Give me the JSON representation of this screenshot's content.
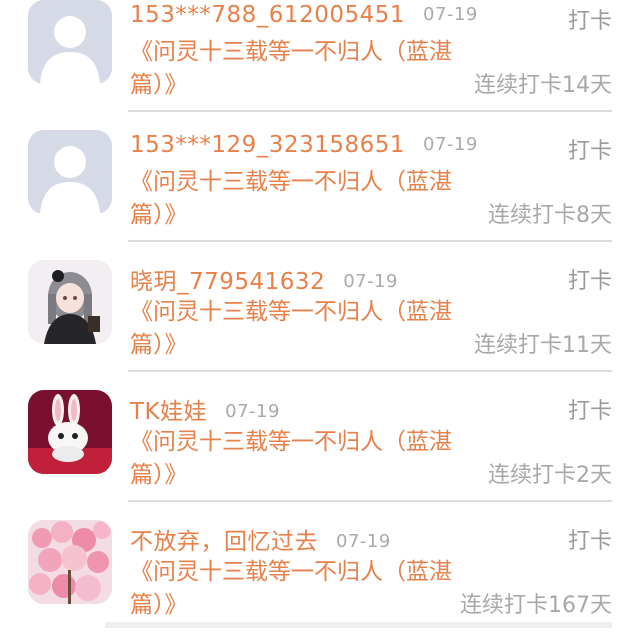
{
  "feed": {
    "items": [
      {
        "username": "153***788_612005451",
        "date": "07-19",
        "action": "打卡",
        "book": "《问灵十三载等一不归人（蓝湛篇）》",
        "streak": "连续打卡14天",
        "avatar": "default-avatar"
      },
      {
        "username": "153***129_323158651",
        "date": "07-19",
        "action": "打卡",
        "book": "《问灵十三载等一不归人（蓝湛篇）》",
        "streak": "连续打卡8天",
        "avatar": "default-avatar"
      },
      {
        "username": "晓玥_779541632",
        "date": "07-19",
        "action": "打卡",
        "book": "《问灵十三载等一不归人（蓝湛篇）》",
        "streak": "连续打卡11天",
        "avatar": "anime-girl-avatar"
      },
      {
        "username": "TK娃娃",
        "date": "07-19",
        "action": "打卡",
        "book": "《问灵十三载等一不归人（蓝湛篇）》",
        "streak": "连续打卡2天",
        "avatar": "rabbit-avatar"
      },
      {
        "username": "不放弃，回忆过去",
        "date": "07-19",
        "action": "打卡",
        "book": "《问灵十三载等一不归人（蓝湛篇）》",
        "streak": "连续打卡167天",
        "avatar": "blossom-avatar"
      }
    ]
  },
  "colors": {
    "accent": "#e8804a",
    "muted": "#aaaaaa",
    "divider": "#dcdcdc"
  }
}
